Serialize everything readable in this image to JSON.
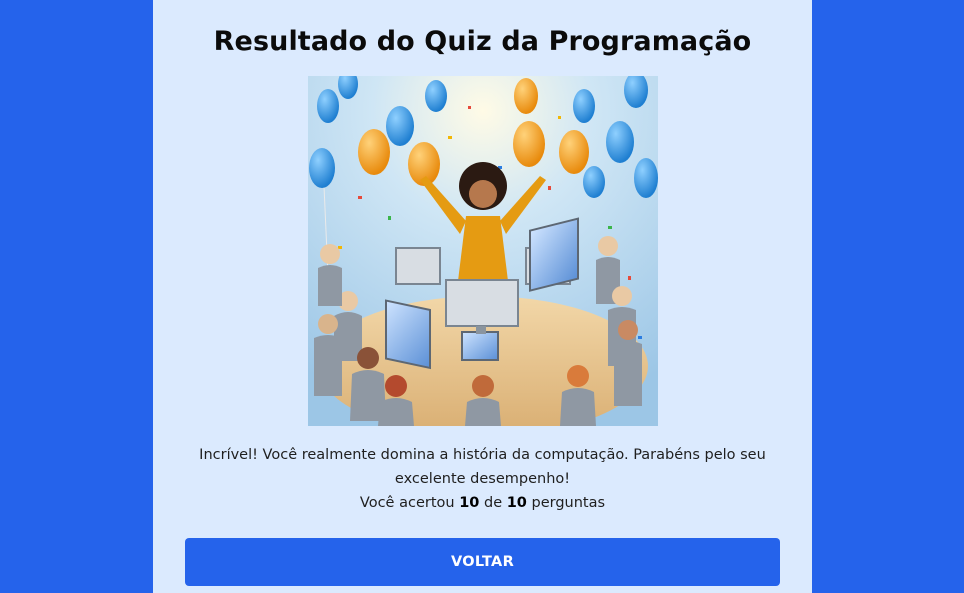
{
  "page": {
    "title": "Resultado do Quiz da Programação",
    "illustration_alt": "celebration-illustration",
    "message": "Incrível! Você realmente domina a história da computação. Parabéns pelo seu excelente desempenho!",
    "score": {
      "prefix": "Você acertou",
      "correct": "10",
      "middle": "de",
      "total": "10",
      "suffix": "perguntas"
    },
    "back_button_label": "VOLTAR"
  },
  "colors": {
    "background": "#2563eb",
    "card": "#dbeafe",
    "button": "#2563eb",
    "button_text": "#ffffff"
  }
}
